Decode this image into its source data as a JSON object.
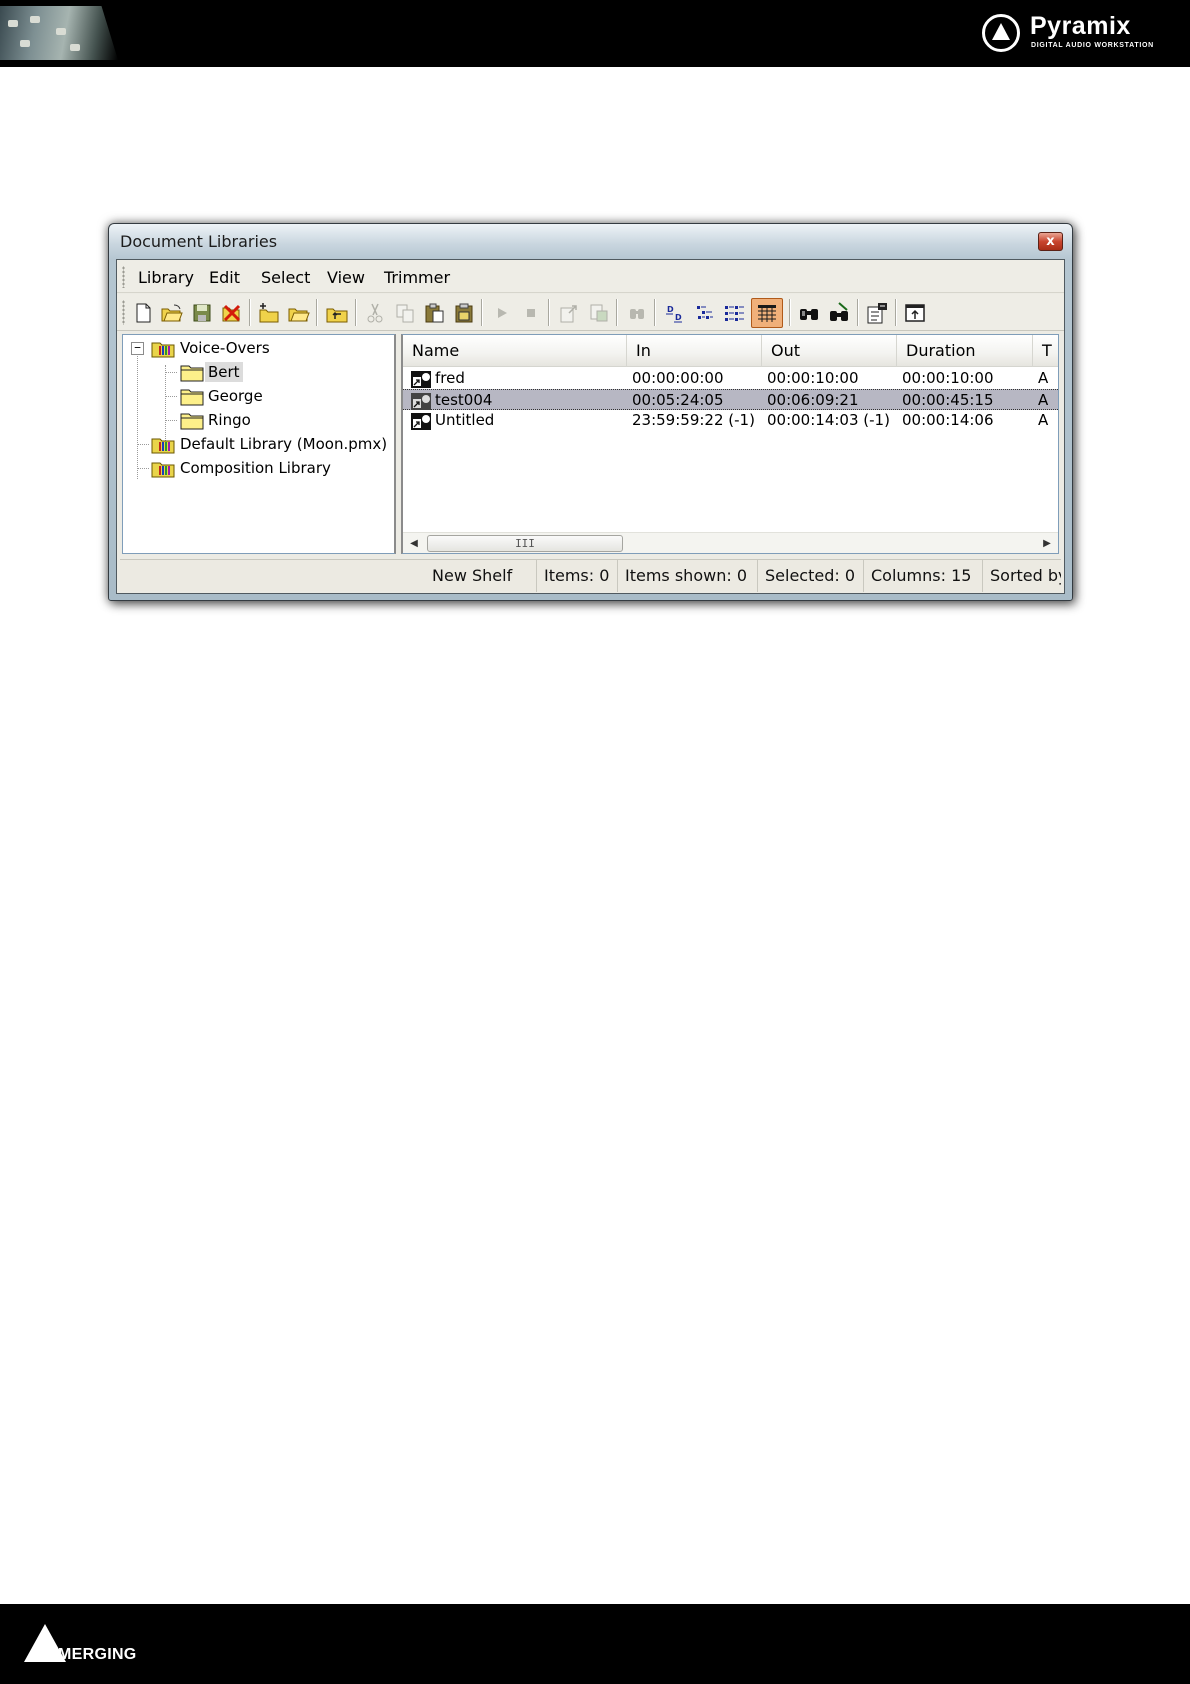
{
  "page": {
    "logo_name": "Pyramix",
    "logo_tagline": "DIGITAL AUDIO WORKSTATION",
    "footer_brand": "MERGING"
  },
  "window": {
    "title": "Document Libraries",
    "close_glyph": "x"
  },
  "menu": [
    {
      "label": "Library"
    },
    {
      "label": "Edit"
    },
    {
      "label": "Select"
    },
    {
      "label": "View"
    },
    {
      "label": "Trimmer"
    }
  ],
  "toolbar": [
    {
      "icon": "new-document-icon",
      "enabled": true
    },
    {
      "icon": "open-folder-icon",
      "enabled": true
    },
    {
      "icon": "save-icon",
      "enabled": true
    },
    {
      "icon": "delete-icon",
      "enabled": true
    },
    {
      "icon": "new-folder-icon",
      "enabled": true
    },
    {
      "icon": "open-folder-icon",
      "enabled": true
    },
    {
      "icon": "folder-up-icon",
      "enabled": true
    },
    {
      "icon": "cut-icon",
      "enabled": false
    },
    {
      "icon": "copy-icon",
      "enabled": false
    },
    {
      "icon": "paste-icon",
      "enabled": true
    },
    {
      "icon": "paste-special-icon",
      "enabled": true
    },
    {
      "icon": "play-icon",
      "enabled": false
    },
    {
      "icon": "stop-icon",
      "enabled": false
    },
    {
      "icon": "export-icon",
      "enabled": false
    },
    {
      "icon": "import-icon",
      "enabled": false
    },
    {
      "icon": "find-icon",
      "enabled": false
    },
    {
      "icon": "large-icons-view-icon",
      "enabled": true
    },
    {
      "icon": "small-icons-view-icon",
      "enabled": true
    },
    {
      "icon": "list-view-icon",
      "enabled": true
    },
    {
      "icon": "details-view-icon",
      "enabled": true,
      "active": true
    },
    {
      "icon": "search-icon",
      "enabled": true
    },
    {
      "icon": "search-advanced-icon",
      "enabled": true
    },
    {
      "icon": "properties-icon",
      "enabled": true
    },
    {
      "icon": "pop-out-icon",
      "enabled": true
    }
  ],
  "tree": [
    {
      "label": "Voice-Overs",
      "icon": "library-icon",
      "expanded": true,
      "level": 0
    },
    {
      "label": "Bert",
      "icon": "folder-icon",
      "level": 1,
      "selected": true
    },
    {
      "label": "George",
      "icon": "folder-icon",
      "level": 1
    },
    {
      "label": "Ringo",
      "icon": "folder-icon",
      "level": 1
    },
    {
      "label": "Default Library (Moon.pmx)",
      "icon": "library-icon",
      "level": 0
    },
    {
      "label": "Composition Library",
      "icon": "library-icon",
      "level": 0
    }
  ],
  "list": {
    "columns": [
      "Name",
      "In",
      "Out",
      "Duration",
      "T"
    ],
    "rows": [
      {
        "name": "fred",
        "in": "00:00:00:00",
        "out": "00:00:10:00",
        "duration": "00:00:10:00",
        "t": "A",
        "selected": false
      },
      {
        "name": "test004",
        "in": "00:05:24:05",
        "out": "00:06:09:21",
        "duration": "00:00:45:15",
        "t": "A",
        "selected": true
      },
      {
        "name": "Untitled",
        "in": "23:59:59:22 (-1)",
        "out": "00:00:14:03 (-1)",
        "duration": "00:00:14:06",
        "t": "A",
        "selected": false
      }
    ],
    "scroll_grip": "III"
  },
  "status": [
    {
      "key": "shelf",
      "text": "New Shelf"
    },
    {
      "key": "items",
      "text": "Items: 0"
    },
    {
      "key": "items_shown",
      "text": "Items shown: 0"
    },
    {
      "key": "selected",
      "text": "Selected: 0"
    },
    {
      "key": "columns",
      "text": "Columns: 15"
    },
    {
      "key": "sorted",
      "text": "Sorted by"
    }
  ]
}
